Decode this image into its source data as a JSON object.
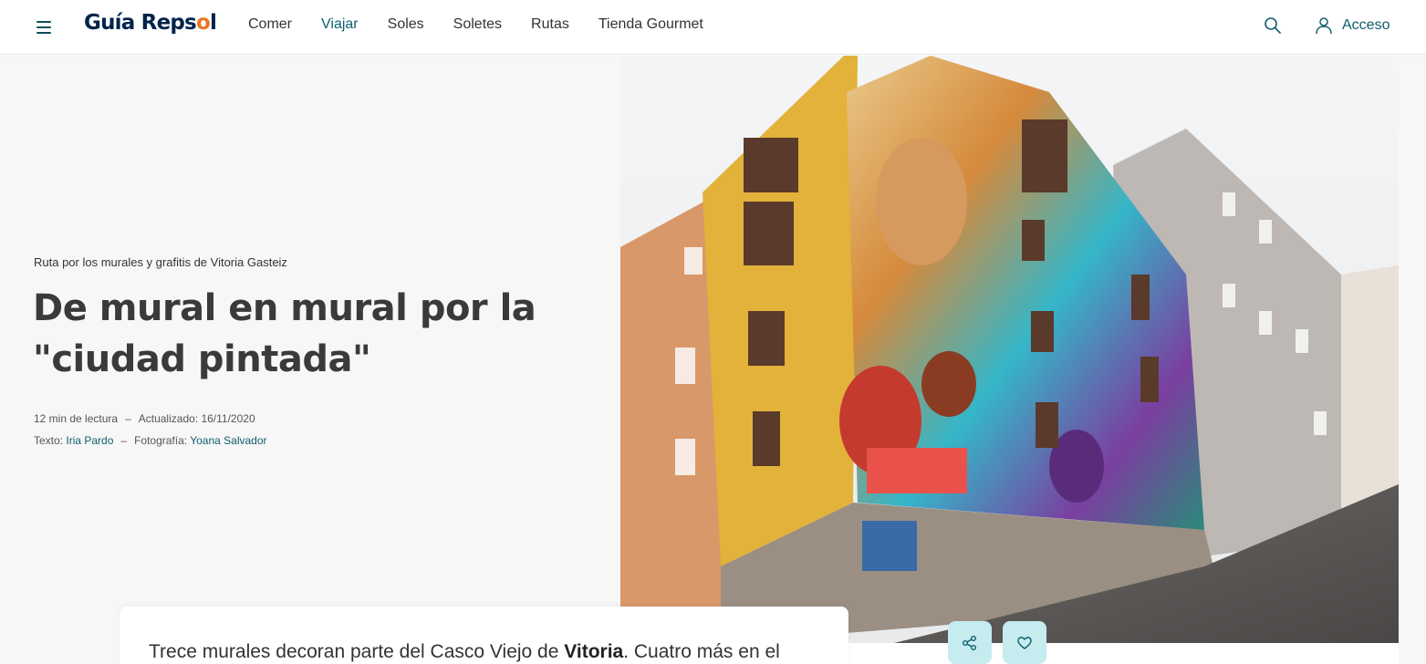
{
  "header": {
    "logo_text_part1": "Guía Reps",
    "logo_text_accent": "o",
    "logo_text_part2": "l",
    "nav": [
      "Comer",
      "Viajar",
      "Soles",
      "Soletes",
      "Rutas",
      "Tienda Gourmet"
    ],
    "active_nav": "Viajar",
    "login_label": "Acceso",
    "icons": {
      "menu": "hamburger-menu-icon",
      "search": "search-icon",
      "user": "user-icon"
    }
  },
  "article": {
    "kicker": "Ruta por los murales y grafitis de Vitoria Gasteiz",
    "title": "De mural en mural por la \"ciudad pintada\"",
    "reading_time": "12 min de lectura",
    "dash1": "–",
    "updated_label": "Actualizado: 16/11/2020",
    "text_label": "Texto:",
    "text_author": "Iria Pardo",
    "dash2": "–",
    "photo_label": "Fotografía:",
    "photo_author": "Yoana Salvador",
    "intro_start": "Trece murales decoran parte del Casco Viejo de ",
    "intro_bold": "Vitoria",
    "intro_end": ". Cuatro más en el"
  },
  "actions": {
    "share_icon": "share-icon",
    "favorite_icon": "heart-icon"
  },
  "colors": {
    "accent": "#0f5e6e",
    "panel_bg": "#f7f7f7",
    "action_bg": "#c6ecef",
    "title": "#3a3a3a"
  }
}
